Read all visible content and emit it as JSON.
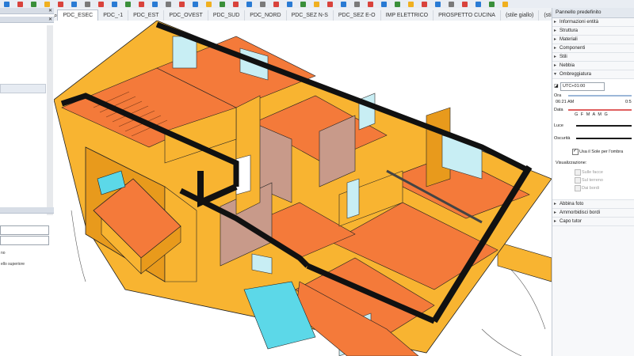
{
  "tabs": [
    {
      "label": "PDC_ESEC",
      "active": true
    },
    {
      "label": "PDC_-1"
    },
    {
      "label": "PDC_EST"
    },
    {
      "label": "PDC_OVEST"
    },
    {
      "label": "PDC_SUD"
    },
    {
      "label": "PDC_NORD"
    },
    {
      "label": "PDC_SEZ N-S"
    },
    {
      "label": "PDC_SEZ E-O"
    },
    {
      "label": "IMP ELETTRICO"
    },
    {
      "label": "PROSPETTO CUCINA"
    },
    {
      "label": "(stile giallo)"
    },
    {
      "label": "(stile ross"
    }
  ],
  "left_panel": {
    "text_1": "no",
    "text_2": "ello superiore"
  },
  "right_panel": {
    "title": "Pannello predefinito",
    "sections_top": [
      "Informazioni entità",
      "Struttura",
      "Materiali",
      "Componenti",
      "Stili",
      "Nebbia"
    ],
    "shadows": {
      "title": "Ombreggiatura",
      "timezone": "UTC+01:00",
      "time_label": "Ora",
      "time_value": "06:21 AM",
      "time_value_right": "0:5",
      "date_label": "Data",
      "months": "G  F  M  A  M  G",
      "light_label": "Luce",
      "dark_label": "Oscurità",
      "use_sun": "Usa il Sole per l'ombra",
      "show_label": "Visualizzazione:",
      "on_faces": "Sulle facce",
      "on_ground": "Sul terreno",
      "from_edges": "Dai bordi"
    },
    "sections_bottom": [
      "Abbina foto",
      "Ammorbidisci bordi",
      "Capo tutor"
    ]
  },
  "colors": {
    "wall_yellow": "#F8B431",
    "wall_side": "#E89A1C",
    "floor_orange": "#F47A3A",
    "brick": "#C89A8A",
    "cut_black": "#111111",
    "glass": "#C8EEF4",
    "terrace_cyan": "#5CD8E8"
  }
}
